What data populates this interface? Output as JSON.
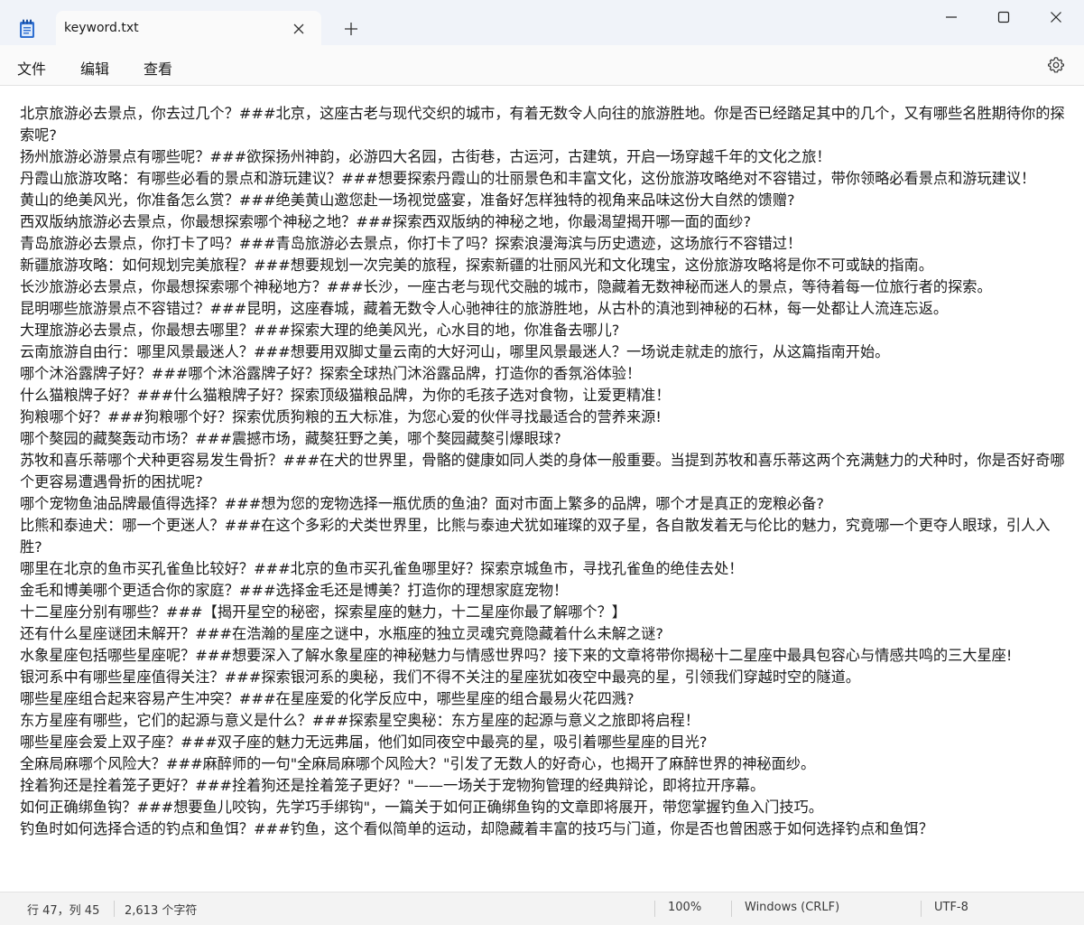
{
  "tab": {
    "title": "keyword.txt"
  },
  "icons": {
    "app": "notepad-icon",
    "tab_close": "close-icon",
    "new_tab": "plus-icon",
    "minimize": "minimize-icon",
    "maximize": "maximize-icon",
    "close": "close-icon",
    "settings": "gear-icon"
  },
  "menu": {
    "file": "文件",
    "edit": "编辑",
    "view": "查看"
  },
  "editor": {
    "lines": [
      "北京旅游必去景点，你去过几个？###北京，这座古老与现代交织的城市，有着无数令人向往的旅游胜地。你是否已经踏足其中的几个，又有哪些名胜期待你的探索呢?",
      "扬州旅游必游景点有哪些呢？###欲探扬州神韵，必游四大名园，古街巷，古运河，古建筑，开启一场穿越千年的文化之旅！",
      "丹霞山旅游攻略：有哪些必看的景点和游玩建议？###想要探索丹霞山的壮丽景色和丰富文化，这份旅游攻略绝对不容错过，带你领略必看景点和游玩建议！",
      "黄山的绝美风光，你准备怎么赏？###绝美黄山邀您赴一场视觉盛宴，准备好怎样独特的视角来品味这份大自然的馈赠?",
      "西双版纳旅游必去景点，你最想探索哪个神秘之地？###探索西双版纳的神秘之地，你最渴望揭开哪一面的面纱?",
      "青岛旅游必去景点，你打卡了吗？###青岛旅游必去景点，你打卡了吗？探索浪漫海滨与历史遗迹，这场旅行不容错过！",
      "新疆旅游攻略：如何规划完美旅程？###想要规划一次完美的旅程，探索新疆的壮丽风光和文化瑰宝，这份旅游攻略将是你不可或缺的指南。",
      "长沙旅游必去景点，你最想探索哪个神秘地方？###长沙，一座古老与现代交融的城市，隐藏着无数神秘而迷人的景点，等待着每一位旅行者的探索。",
      "昆明哪些旅游景点不容错过？###昆明，这座春城，藏着无数令人心驰神往的旅游胜地，从古朴的滇池到神秘的石林，每一处都让人流连忘返。",
      "大理旅游必去景点，你最想去哪里？###探索大理的绝美风光，心水目的地，你准备去哪儿?",
      "云南旅游自由行：哪里风景最迷人？###想要用双脚丈量云南的大好河山，哪里风景最迷人？一场说走就走的旅行，从这篇指南开始。",
      "哪个沐浴露牌子好？###哪个沐浴露牌子好？探索全球热门沐浴露品牌，打造你的香氛浴体验！",
      "什么猫粮牌子好？###什么猫粮牌子好？探索顶级猫粮品牌，为你的毛孩子选对食物，让爱更精准！",
      "狗粮哪个好？###狗粮哪个好？探索优质狗粮的五大标准，为您心爱的伙伴寻找最适合的营养来源!",
      "哪个獒园的藏獒轰动市场？###震撼市场，藏獒狂野之美，哪个獒园藏獒引爆眼球?",
      "苏牧和喜乐蒂哪个犬种更容易发生骨折？###在犬的世界里，骨骼的健康如同人类的身体一般重要。当提到苏牧和喜乐蒂这两个充满魅力的犬种时，你是否好奇哪个更容易遭遇骨折的困扰呢?",
      "哪个宠物鱼油品牌最值得选择？###想为您的宠物选择一瓶优质的鱼油？面对市面上繁多的品牌，哪个才是真正的宠粮必备?",
      "比熊和泰迪犬：哪一个更迷人？###在这个多彩的犬类世界里，比熊与泰迪犬犹如璀璨的双子星，各自散发着无与伦比的魅力，究竟哪一个更夺人眼球，引人入胜?",
      "哪里在北京的鱼市买孔雀鱼比较好？###北京的鱼市买孔雀鱼哪里好？探索京城鱼市，寻找孔雀鱼的绝佳去处！",
      "金毛和博美哪个更适合你的家庭？###选择金毛还是博美？打造你的理想家庭宠物！",
      "十二星座分别有哪些？###【揭开星空的秘密，探索星座的魅力，十二星座你最了解哪个？】",
      "还有什么星座谜团未解开？###在浩瀚的星座之谜中，水瓶座的独立灵魂究竟隐藏着什么未解之谜?",
      "水象星座包括哪些星座呢？###想要深入了解水象星座的神秘魅力与情感世界吗？接下来的文章将带你揭秘十二星座中最具包容心与情感共鸣的三大星座!",
      "银河系中有哪些星座值得关注？###探索银河系的奥秘，我们不得不关注的星座犹如夜空中最亮的星，引领我们穿越时空的隧道。",
      "哪些星座组合起来容易产生冲突？###在星座爱的化学反应中，哪些星座的组合最易火花四溅?",
      "东方星座有哪些，它们的起源与意义是什么？###探索星空奥秘：东方星座的起源与意义之旅即将启程！",
      "哪些星座会爱上双子座？###双子座的魅力无远弗届，他们如同夜空中最亮的星，吸引着哪些星座的目光?",
      "全麻局麻哪个风险大？###麻醉师的一句\"全麻局麻哪个风险大？\"引发了无数人的好奇心，也揭开了麻醉世界的神秘面纱。",
      "拴着狗还是拴着笼子更好？###拴着狗还是拴着笼子更好？\"——一场关于宠物狗管理的经典辩论，即将拉开序幕。",
      "如何正确绑鱼钩？###想要鱼儿咬钩，先学巧手绑钩\"，一篇关于如何正确绑鱼钩的文章即将展开，带您掌握钓鱼入门技巧。",
      "钓鱼时如何选择合适的钓点和鱼饵？###钓鱼，这个看似简单的运动，却隐藏着丰富的技巧与门道，你是否也曾困惑于如何选择钓点和鱼饵？"
    ]
  },
  "status": {
    "position": "行 47，列 45",
    "char_count": "2,613 个字符",
    "zoom": "100%",
    "line_ending": "Windows (CRLF)",
    "encoding": "UTF-8"
  }
}
